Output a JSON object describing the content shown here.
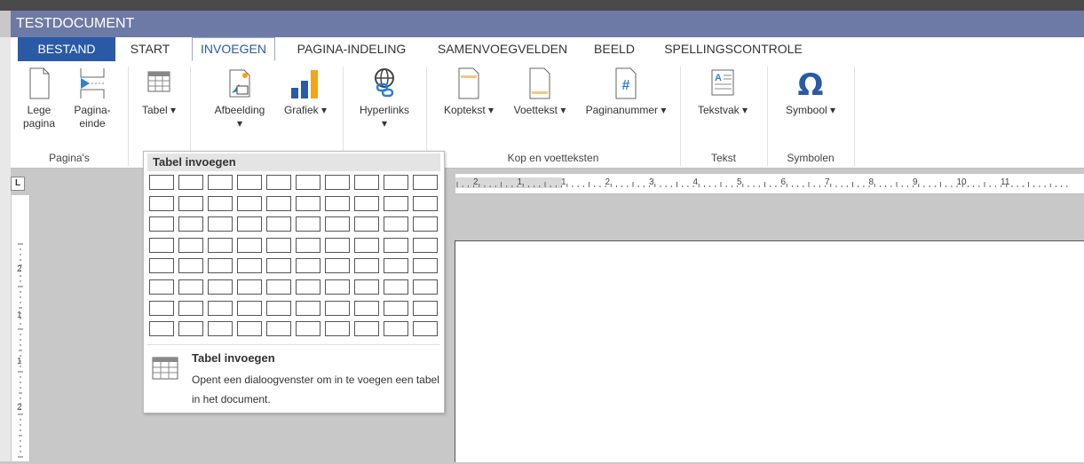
{
  "app_title": "TESTDOCUMENT",
  "tabs": [
    "BESTAND",
    "START",
    "INVOEGEN",
    "PAGINA-INDELING",
    "SAMENVOEGVELDEN",
    "BEELD",
    "SPELLINGSCONTROLE"
  ],
  "active_tab": "INVOEGEN",
  "ribbon": {
    "groups": [
      {
        "label": "Pagina's",
        "commands": [
          "Lege\npagina",
          "Pagina-\neinde"
        ]
      },
      {
        "label": "",
        "commands": [
          "Tabel ▾"
        ]
      },
      {
        "label": "",
        "commands": [
          "Afbeelding\n▾",
          "Grafiek ▾"
        ]
      },
      {
        "label": "",
        "commands": [
          "Hyperlinks\n▾"
        ]
      },
      {
        "label": "Kop en voetteksten",
        "commands": [
          "Koptekst ▾",
          "Voettekst ▾",
          "Paginanummer ▾"
        ]
      },
      {
        "label": "Tekst",
        "commands": [
          "Tekstvak ▾"
        ]
      },
      {
        "label": "Symbolen",
        "commands": [
          "Symbool ▾"
        ]
      }
    ]
  },
  "dropdown": {
    "title": "Tabel invoegen",
    "grid": {
      "columns": 10,
      "rows": 8
    },
    "footer_title": "Tabel invoegen",
    "footer_desc": "Opent een dialoogvenster om in te voegen een tabel in het document."
  },
  "corner_marker": "L",
  "ruler": {
    "h_labels": [
      "2",
      "1",
      "1",
      "2",
      "3",
      "4",
      "5",
      "6",
      "7",
      "8",
      "9",
      "10",
      "11"
    ],
    "v_labels": [
      "2",
      "1",
      "1",
      "2"
    ]
  },
  "colors": {
    "title_bar": "#6e7aa6",
    "file_tab": "#2a5aa6",
    "accent_blue": "#2d7fd1",
    "chart_orange": "#f3a41a"
  }
}
